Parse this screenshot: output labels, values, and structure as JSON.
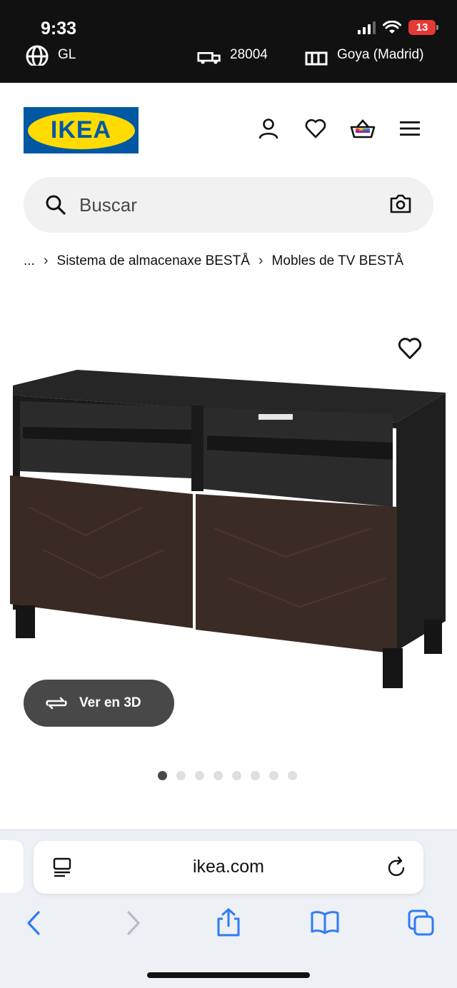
{
  "status": {
    "time": "9:33",
    "battery": "13"
  },
  "strip": {
    "lang": "GL",
    "postcode": "28004",
    "store": "Goya (Madrid)"
  },
  "logo": {
    "text": "IKEA"
  },
  "search": {
    "placeholder": "Buscar"
  },
  "breadcrumb": {
    "ellipsis": "...",
    "items": [
      "Sistema de almacenaxe BESTÅ",
      "Mobles de TV BESTÅ"
    ]
  },
  "product": {
    "view_3d_label": "Ver en 3D",
    "image_count": 8,
    "active_image": 1
  },
  "browser": {
    "url": "ikea.com"
  },
  "colors": {
    "ikea_blue": "#0058a3",
    "ikea_yellow": "#ffdb00",
    "button_dark": "#484848",
    "safari_blue": "#2f7bf6"
  }
}
